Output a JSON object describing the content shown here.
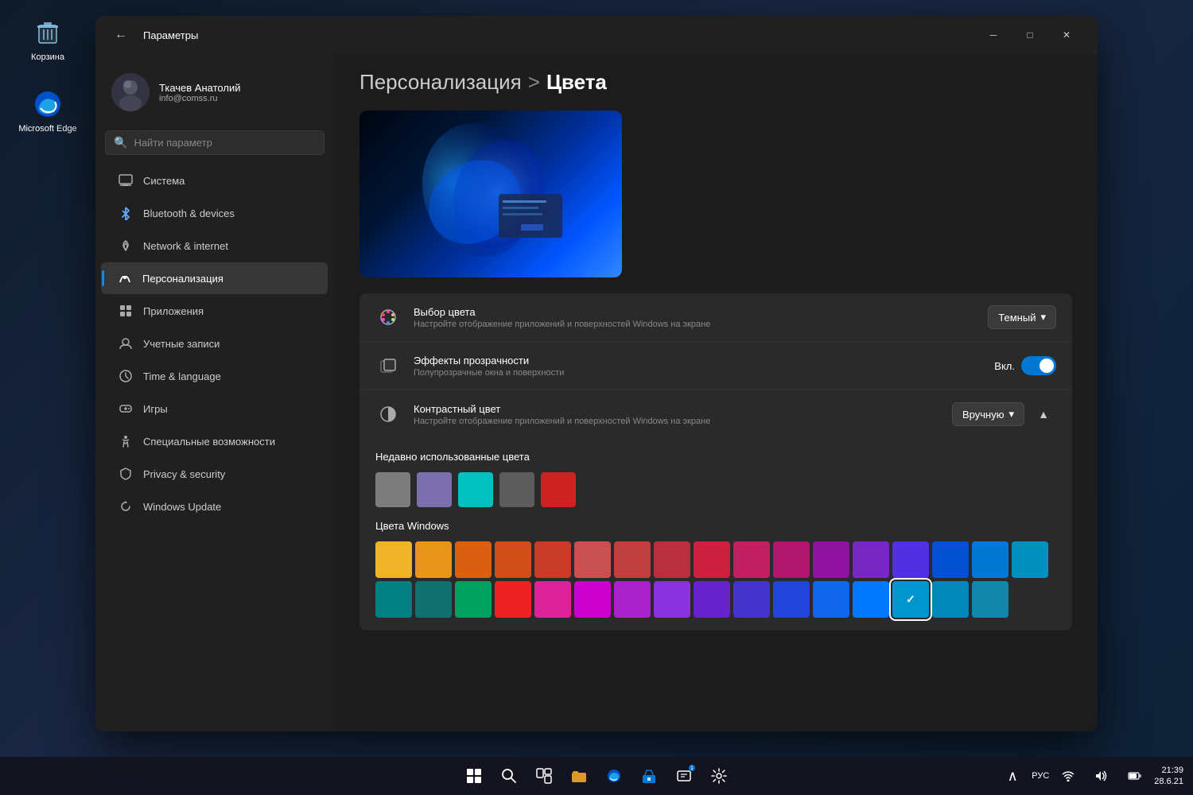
{
  "desktop": {
    "icons": [
      {
        "id": "recycle-bin",
        "label": "Корзина",
        "icon": "🗑"
      },
      {
        "id": "edge",
        "label": "Microsoft Edge",
        "icon": "🌐"
      }
    ]
  },
  "taskbar": {
    "time": "21:39",
    "date": "28.6.21",
    "language": "РУС",
    "icons": [
      "⊞",
      "🔍",
      "⬛",
      "📁",
      "🌐",
      "🏦",
      "🎮",
      "⚙"
    ]
  },
  "window": {
    "title": "Параметры",
    "back_btn": "←",
    "controls": {
      "min": "─",
      "max": "□",
      "close": "✕"
    }
  },
  "user": {
    "name": "Ткачев Анатолий",
    "email": "info@comss.ru"
  },
  "search": {
    "placeholder": "Найти параметр"
  },
  "nav": {
    "items": [
      {
        "id": "system",
        "label": "Система",
        "icon": "💻",
        "active": false
      },
      {
        "id": "bluetooth",
        "label": "Bluetooth & devices",
        "icon": "🔵",
        "active": false
      },
      {
        "id": "network",
        "label": "Network & internet",
        "icon": "📡",
        "active": false
      },
      {
        "id": "personalization",
        "label": "Персонализация",
        "icon": "✏",
        "active": true
      },
      {
        "id": "apps",
        "label": "Приложения",
        "icon": "📦",
        "active": false
      },
      {
        "id": "accounts",
        "label": "Учетные записи",
        "icon": "👤",
        "active": false
      },
      {
        "id": "time",
        "label": "Time & language",
        "icon": "🕐",
        "active": false
      },
      {
        "id": "gaming",
        "label": "Игры",
        "icon": "🎮",
        "active": false
      },
      {
        "id": "accessibility",
        "label": "Специальные возможности",
        "icon": "♿",
        "active": false
      },
      {
        "id": "privacy",
        "label": "Privacy & security",
        "icon": "🛡",
        "active": false
      },
      {
        "id": "update",
        "label": "Windows Update",
        "icon": "🔄",
        "active": false
      }
    ]
  },
  "content": {
    "breadcrumb_parent": "Персонализация",
    "breadcrumb_sep": ">",
    "breadcrumb_child": "Цвета",
    "rows": [
      {
        "id": "color-choice",
        "icon": "🎨",
        "title": "Выбор цвета",
        "subtitle": "Настройте отображение приложений и поверхностей Windows на экране",
        "control_type": "dropdown",
        "control_value": "Темный"
      },
      {
        "id": "transparency",
        "icon": "🪟",
        "title": "Эффекты прозрачности",
        "subtitle": "Полупрозрачные окна и поверхности",
        "control_type": "toggle",
        "control_label": "Вкл.",
        "toggle_on": true
      },
      {
        "id": "contrast-color",
        "icon": "🎯",
        "title": "Контрастный цвет",
        "subtitle": "Настройте отображение приложений и поверхностей Windows на экране",
        "control_type": "dropdown-expand",
        "control_value": "Вручную"
      }
    ],
    "recent_colors_title": "Недавно использованные цвета",
    "recent_colors": [
      "#7c7c7c",
      "#7b6fad",
      "#00c0c0",
      "#5c5c5c",
      "#cc2222"
    ],
    "windows_colors_title": "Цвета Windows",
    "windows_colors": [
      "#f0b428",
      "#e8941a",
      "#d96010",
      "#d04f18",
      "#c83c28",
      "#c85050",
      "#c04040",
      "#b83040",
      "#cc2040",
      "#c02060",
      "#b01870",
      "#9010a0",
      "#7828c0",
      "#5030e0",
      "#0050d0",
      "#0078d4",
      "#0090c0",
      "#008080",
      "#107070",
      "#00a060"
    ],
    "selected_color_index": 16,
    "more_colors": [
      "#602080",
      "#7040a0",
      "#9050c0",
      "#a060d0",
      "#0095cf",
      "#009bbf",
      "#009fac"
    ]
  }
}
